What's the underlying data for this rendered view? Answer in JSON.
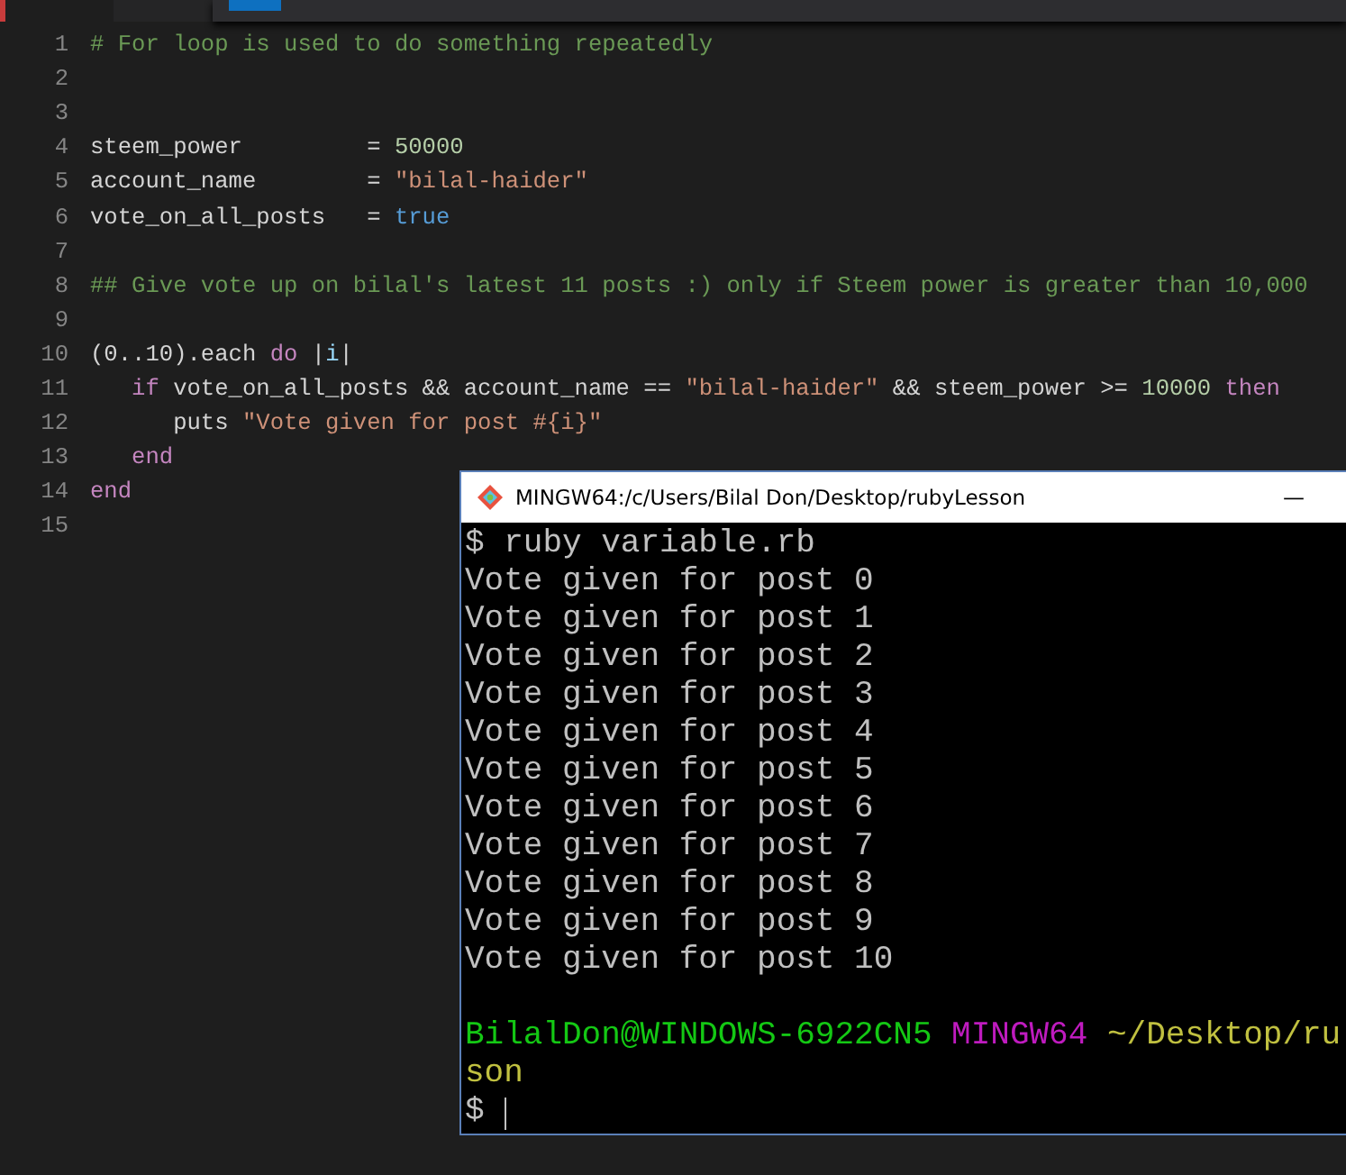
{
  "editor": {
    "lines": [
      {
        "number": "1",
        "tokens": [
          {
            "text": "# For loop is used to do something repeatedly",
            "kind": "comment"
          }
        ]
      },
      {
        "number": "2"
      },
      {
        "number": "3"
      },
      {
        "number": "4",
        "tokens": [
          {
            "text": "steem_power         = ",
            "kind": "plain"
          },
          {
            "text": "50000",
            "kind": "number"
          }
        ]
      },
      {
        "number": "5",
        "tokens": [
          {
            "text": "account_name        = ",
            "kind": "plain"
          },
          {
            "text": "\"bilal-haider\"",
            "kind": "string"
          }
        ]
      },
      {
        "number": "6",
        "tokens": [
          {
            "text": "vote_on_all_posts   = ",
            "kind": "plain"
          },
          {
            "text": "true",
            "kind": "constant"
          }
        ]
      },
      {
        "number": "7"
      },
      {
        "number": "8",
        "tokens": [
          {
            "text": "## Give vote up on bilal's latest 11 posts :) only if Steem power is greater than 10,000",
            "kind": "comment"
          }
        ]
      },
      {
        "number": "9"
      },
      {
        "number": "10",
        "tokens": [
          {
            "text": "(0..10).each ",
            "kind": "plain"
          },
          {
            "text": "do",
            "kind": "keyword"
          },
          {
            "text": " |",
            "kind": "plain"
          },
          {
            "text": "i",
            "kind": "variable"
          },
          {
            "text": "|",
            "kind": "plain"
          }
        ],
        "children": [
          {
            "number": "11",
            "tokens": [
              {
                "text": "if",
                "kind": "keyword"
              },
              {
                "text": " vote_on_all_posts && account_name == ",
                "kind": "plain"
              },
              {
                "text": "\"bilal-haider\"",
                "kind": "string"
              },
              {
                "text": " && steem_power >= ",
                "kind": "plain"
              },
              {
                "text": "10000",
                "kind": "number"
              },
              {
                "text": " then",
                "kind": "keyword"
              }
            ],
            "children": [
              {
                "number": "12",
                "tokens": [
                  {
                    "text": "puts ",
                    "kind": "plain"
                  },
                  {
                    "text": "\"Vote given for post #{i}\"",
                    "kind": "string"
                  }
                ]
              }
            ]
          },
          {
            "number": "13",
            "tokens": [
              {
                "text": "end",
                "kind": "keyword"
              }
            ]
          }
        ]
      },
      {
        "number": "14",
        "tokens": [
          {
            "text": "end",
            "kind": "keyword"
          }
        ]
      },
      {
        "number": "15"
      }
    ]
  },
  "terminal": {
    "title": "MINGW64:/c/Users/Bilal Don/Desktop/rubyLesson",
    "minimize": "—",
    "lines": [
      {
        "tokens": [
          {
            "text": "$ ruby variable.rb",
            "kind": "plain"
          }
        ]
      },
      {
        "tokens": [
          {
            "text": "Vote given for post 0",
            "kind": "plain"
          }
        ]
      },
      {
        "tokens": [
          {
            "text": "Vote given for post 1",
            "kind": "plain"
          }
        ]
      },
      {
        "tokens": [
          {
            "text": "Vote given for post 2",
            "kind": "plain"
          }
        ]
      },
      {
        "tokens": [
          {
            "text": "Vote given for post 3",
            "kind": "plain"
          }
        ]
      },
      {
        "tokens": [
          {
            "text": "Vote given for post 4",
            "kind": "plain"
          }
        ]
      },
      {
        "tokens": [
          {
            "text": "Vote given for post 5",
            "kind": "plain"
          }
        ]
      },
      {
        "tokens": [
          {
            "text": "Vote given for post 6",
            "kind": "plain"
          }
        ]
      },
      {
        "tokens": [
          {
            "text": "Vote given for post 7",
            "kind": "plain"
          }
        ]
      },
      {
        "tokens": [
          {
            "text": "Vote given for post 8",
            "kind": "plain"
          }
        ]
      },
      {
        "tokens": [
          {
            "text": "Vote given for post 9",
            "kind": "plain"
          }
        ]
      },
      {
        "tokens": [
          {
            "text": "Vote given for post 10",
            "kind": "plain"
          }
        ]
      },
      {
        "tokens": [
          {
            "text": "BilalDon@WINDOWS-6922CN5",
            "kind": "user"
          },
          {
            "text": " MINGW64",
            "kind": "host"
          },
          {
            "text": " ~/Desktop/ru",
            "kind": "path"
          }
        ]
      },
      {
        "tokens": [
          {
            "text": "son",
            "kind": "path"
          }
        ]
      },
      {
        "tokens": [
          {
            "text": "$",
            "kind": "plain"
          },
          {
            "kind": "cursor"
          }
        ]
      }
    ]
  }
}
